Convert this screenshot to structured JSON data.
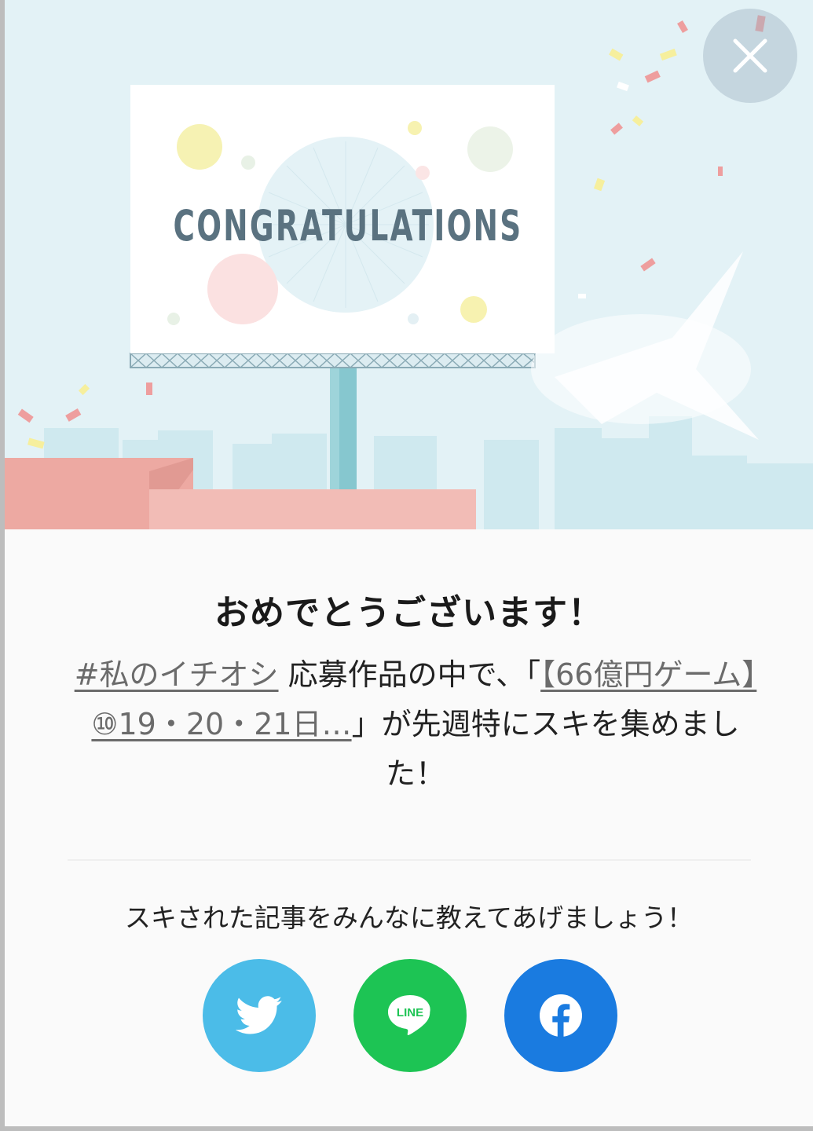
{
  "hero": {
    "billboard_text": "CONGRATULATIONS"
  },
  "close_button": {
    "icon": "close-icon"
  },
  "dialog": {
    "title": "おめでとうございます！",
    "hashtag_link": "#私のイチオシ",
    "text_before_article": " 応募作品の中で、「",
    "article_link": "【66億円ゲーム】⑩19・20・21日…",
    "text_after_article": "」が先週特にスキを集めました！"
  },
  "share": {
    "prompt": "スキされた記事をみんなに教えてあげましょう！",
    "buttons": [
      {
        "name": "Twitter",
        "icon": "twitter-bird-icon",
        "color": "#4bbce8"
      },
      {
        "name": "LINE",
        "icon": "line-icon",
        "label": "LINE",
        "color": "#1dc454"
      },
      {
        "name": "Facebook",
        "icon": "facebook-icon",
        "color": "#1a7be0"
      }
    ]
  }
}
